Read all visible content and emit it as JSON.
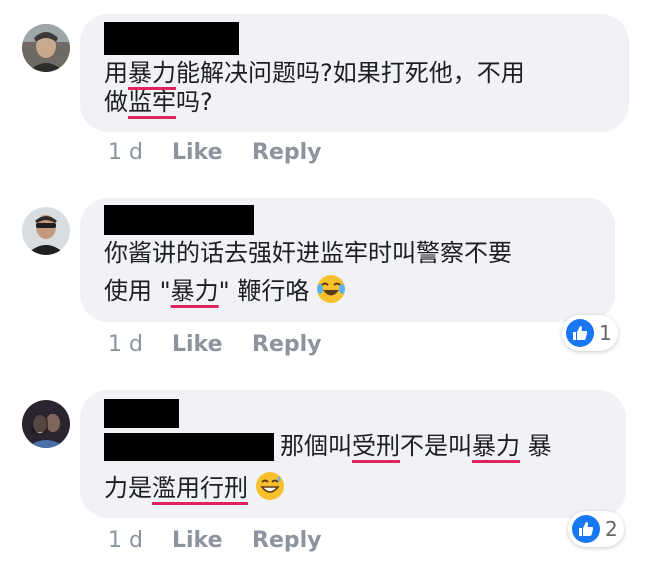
{
  "comments": [
    {
      "text_line1_a": "用",
      "text_line1_u": "暴力",
      "text_line1_b": "能解决问题吗?如果打死他，不用",
      "text_line2_a": "做",
      "text_line2_u": "监牢",
      "text_line2_b": "吗?",
      "time": "1 d",
      "like_label": "Like",
      "reply_label": "Reply",
      "reaction_count": null
    },
    {
      "text_line1": "你酱讲的话去强奸进监牢时叫警察不要",
      "text_line2_a": "使用 \"",
      "text_line2_u": "暴力",
      "text_line2_b": "\" 鞭行咯",
      "emoji": "face-with-tears-of-joy",
      "time": "1 d",
      "like_label": "Like",
      "reply_label": "Reply",
      "reaction_count": "1"
    },
    {
      "text_line1_a": "那個叫",
      "text_line1_u1": "受刑",
      "text_line1_b": "不是叫",
      "text_line1_u2": "暴力",
      "text_line1_c": " 暴",
      "text_line2_a": "力是",
      "text_line2_u": "濫用行刑",
      "emoji": "grinning-face-with-sweat",
      "time": "1 d",
      "like_label": "Like",
      "reply_label": "Reply",
      "reaction_count": "2"
    }
  ],
  "colors": {
    "bubble": "#f0f2f5",
    "underline": "#e0245e",
    "like_blue": "#1877f2",
    "meta_gray": "#8d949e"
  }
}
